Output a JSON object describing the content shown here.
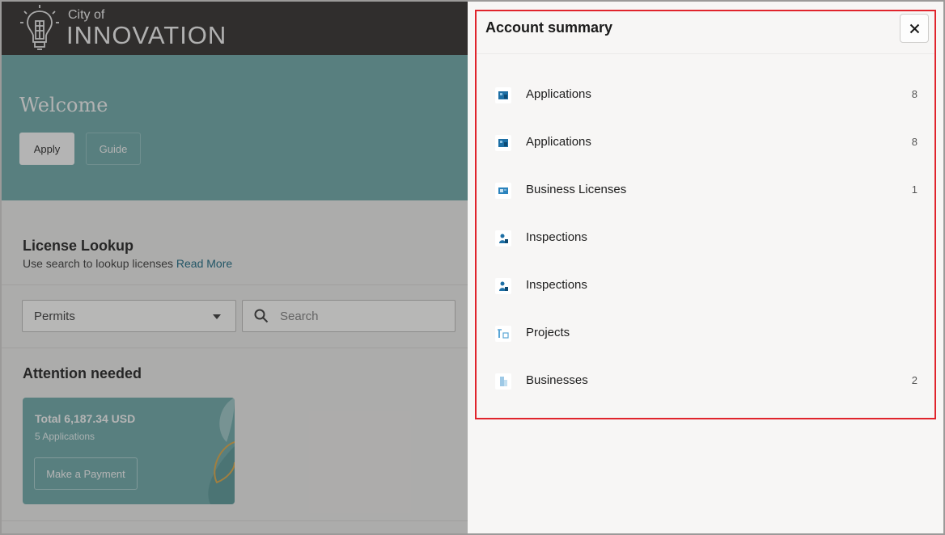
{
  "header": {
    "logo_small": "City of",
    "logo_big": "INNOVATION"
  },
  "hero": {
    "welcome": "Welcome",
    "apply_label": "Apply",
    "guide_label": "Guide"
  },
  "lookup": {
    "title": "License Lookup",
    "subtitle": "Use search to lookup licenses",
    "read_more": "Read More",
    "select_value": "Permits",
    "search_placeholder": "Search"
  },
  "attention": {
    "title": "Attention needed",
    "total": "Total 6,187.34 USD",
    "subtitle": "5 Applications",
    "pay_label": "Make a Payment"
  },
  "drawer": {
    "title": "Account summary",
    "items": [
      {
        "label": "Applications",
        "count": "8",
        "icon": "applications-icon"
      },
      {
        "label": "Applications",
        "count": "8",
        "icon": "applications-icon"
      },
      {
        "label": "Business Licenses",
        "count": "1",
        "icon": "license-card-icon"
      },
      {
        "label": "Inspections",
        "count": "",
        "icon": "inspector-icon"
      },
      {
        "label": "Inspections",
        "count": "",
        "icon": "inspector-icon"
      },
      {
        "label": "Projects",
        "count": "",
        "icon": "projects-icon"
      },
      {
        "label": "Businesses",
        "count": "2",
        "icon": "building-icon"
      }
    ]
  },
  "colors": {
    "header_bg": "#2a2725",
    "teal": "#67a4a4",
    "link": "#13637d",
    "highlight_border": "#e0242c",
    "icon_blue": "#1d6fa5"
  }
}
